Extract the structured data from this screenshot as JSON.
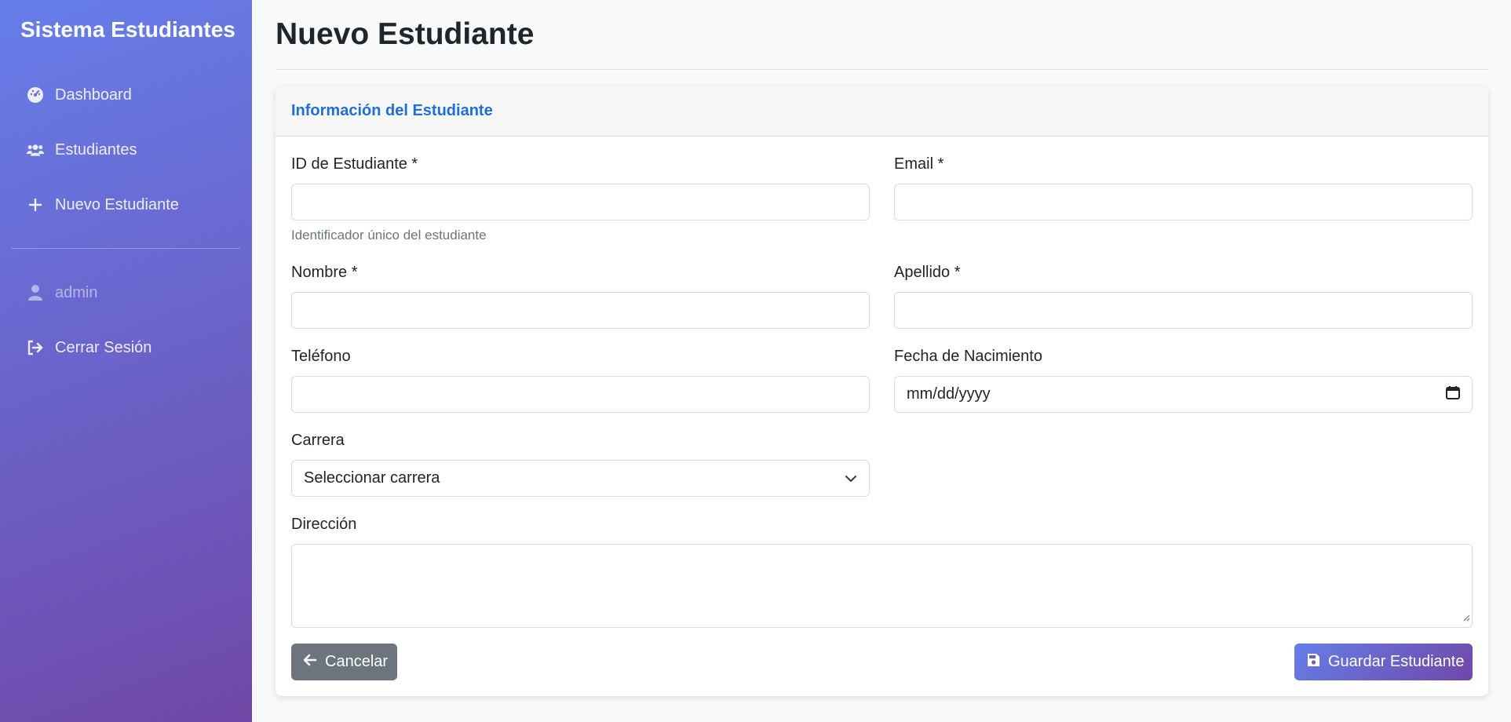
{
  "sidebar": {
    "brand": "Sistema Estudiantes",
    "items": [
      {
        "label": "Dashboard",
        "icon": "gauge-icon"
      },
      {
        "label": "Estudiantes",
        "icon": "users-icon"
      },
      {
        "label": "Nuevo Estudiante",
        "icon": "plus-icon"
      }
    ],
    "user": {
      "label": "admin",
      "icon": "user-icon"
    },
    "logout": {
      "label": "Cerrar Sesión",
      "icon": "sign-out-icon"
    }
  },
  "page": {
    "title": "Nuevo Estudiante"
  },
  "card": {
    "header": "Información del Estudiante"
  },
  "form": {
    "student_id": {
      "label": "ID de Estudiante *",
      "value": "",
      "help": "Identificador único del estudiante"
    },
    "email": {
      "label": "Email *",
      "value": ""
    },
    "first_name": {
      "label": "Nombre *",
      "value": ""
    },
    "last_name": {
      "label": "Apellido *",
      "value": ""
    },
    "phone": {
      "label": "Teléfono",
      "value": ""
    },
    "birth_date": {
      "label": "Fecha de Nacimiento",
      "placeholder": "mm/dd/yyyy"
    },
    "career": {
      "label": "Carrera",
      "selected": "Seleccionar carrera"
    },
    "address": {
      "label": "Dirección",
      "value": ""
    }
  },
  "buttons": {
    "cancel": "Cancelar",
    "save": "Guardar Estudiante"
  },
  "colors": {
    "sidebar_start": "#667eea",
    "sidebar_end": "#7048a8",
    "header_text": "#1e6fd9",
    "cancel_bg": "#6c757d"
  }
}
